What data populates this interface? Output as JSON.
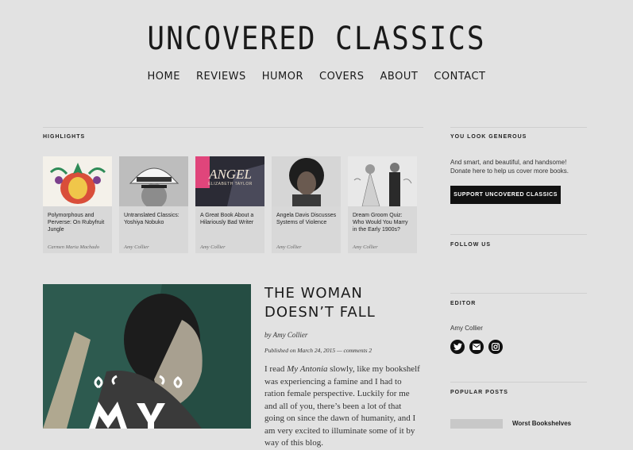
{
  "site": {
    "title": "UNCOVERED CLASSICS"
  },
  "nav": [
    "HOME",
    "REVIEWS",
    "HUMOR",
    "COVERS",
    "ABOUT",
    "CONTACT"
  ],
  "highlights": {
    "heading": "HIGHLIGHTS",
    "cards": [
      {
        "title": "Polymorphous and Perverse: On Rubyfruit Jungle",
        "author": "Carmen Maria Machado"
      },
      {
        "title": "Untranslated Classics: Yoshiya Nobuko",
        "author": "Amy Collier"
      },
      {
        "title": "A Great Book About a Hilariously Bad Writer",
        "author": "Amy Collier",
        "cover_text": "ANGEL",
        "cover_subtext": "ELIZABETH TAYLOR"
      },
      {
        "title": "Angela Davis Discusses Systems of Violence",
        "author": "Amy Collier"
      },
      {
        "title": "Dream Groom Quiz: Who Would You Marry in the Early 1900s?",
        "author": "Amy Collier"
      }
    ]
  },
  "post": {
    "title": "THE WOMAN DOESN’T FALL",
    "byline_prefix": "by ",
    "author": "Amy Collier",
    "published_prefix": "Published on ",
    "date": "March 24, 2015",
    "separator": " — ",
    "comments": "comments 2",
    "excerpt_before": "I read ",
    "excerpt_italic": "My Antonia",
    "excerpt_after": " slowly, like my bookshelf was experiencing a famine and I had to ration female perspective. Luckily for me and all of you, there’s been a lot of that going on since the dawn of humanity, and I am very excited to illuminate some of it by way of this blog."
  },
  "sidebar": {
    "generous_heading": "YOU LOOK GENEROUS",
    "generous_text": "And smart, and beautiful, and handsome! Donate here to help us cover more books.",
    "support_button": "SUPPORT UNCOVERED CLASSICS",
    "follow_heading": "FOLLOW US",
    "editor_heading": "EDITOR",
    "editor_name": "Amy Collier",
    "social_icons": [
      "twitter-icon",
      "email-icon",
      "instagram-icon"
    ],
    "popular_heading": "POPULAR POSTS",
    "popular_first": "Worst Bookshelves"
  },
  "colors": {
    "background": "#e2e2e2",
    "text": "#1a1a1a",
    "button": "#111111",
    "cover_green": "#2d5a4f",
    "cover_pink": "#e0457b"
  }
}
